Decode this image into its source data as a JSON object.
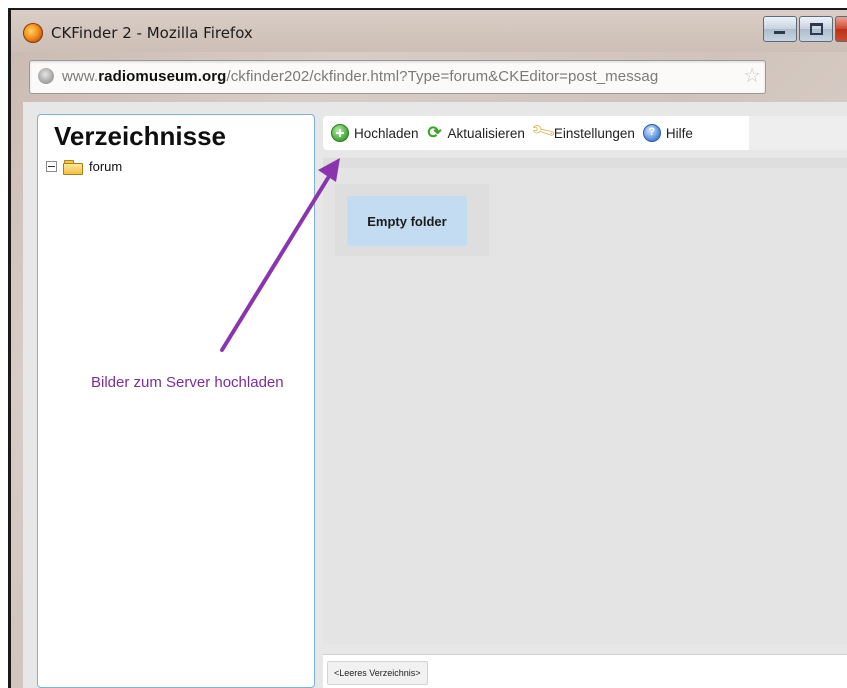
{
  "window": {
    "title": "CKFinder 2 - Mozilla Firefox",
    "controls": [
      "minimize-icon",
      "maximize-icon",
      "close-icon"
    ]
  },
  "address_bar": {
    "url_domain": "www.radiomuseum.org",
    "url_prefix": "www.",
    "url_domain_bold": "radiomuseum.org",
    "url_path": "/ckfinder202/ckfinder.html?Type=forum&CKEditor=post_messag",
    "icons": [
      "globe-icon",
      "star-icon"
    ]
  },
  "sidebar": {
    "title": "Verzeichnisse",
    "tree": [
      {
        "label": "forum",
        "icon": "folder-icon",
        "expanded": true
      }
    ]
  },
  "toolbar": {
    "items": [
      {
        "label": "Hochladen",
        "icon": "plus-icon"
      },
      {
        "label": "Aktualisieren",
        "icon": "refresh-icon"
      },
      {
        "label": "Einstellungen",
        "icon": "wrench-icon"
      },
      {
        "label": "Hilfe",
        "icon": "help-icon"
      }
    ]
  },
  "files": {
    "empty_label": "Empty folder"
  },
  "status_bar": {
    "label": "<Leeres Verzeichnis>"
  },
  "annotation": {
    "text": "Bilder zum Server hochladen",
    "color": "#7a2e9b"
  },
  "colors": {
    "panel_border": "#7eb1dd",
    "empty_folder_bg": "#c3dcf1",
    "annotation": "#7a2e9b"
  }
}
